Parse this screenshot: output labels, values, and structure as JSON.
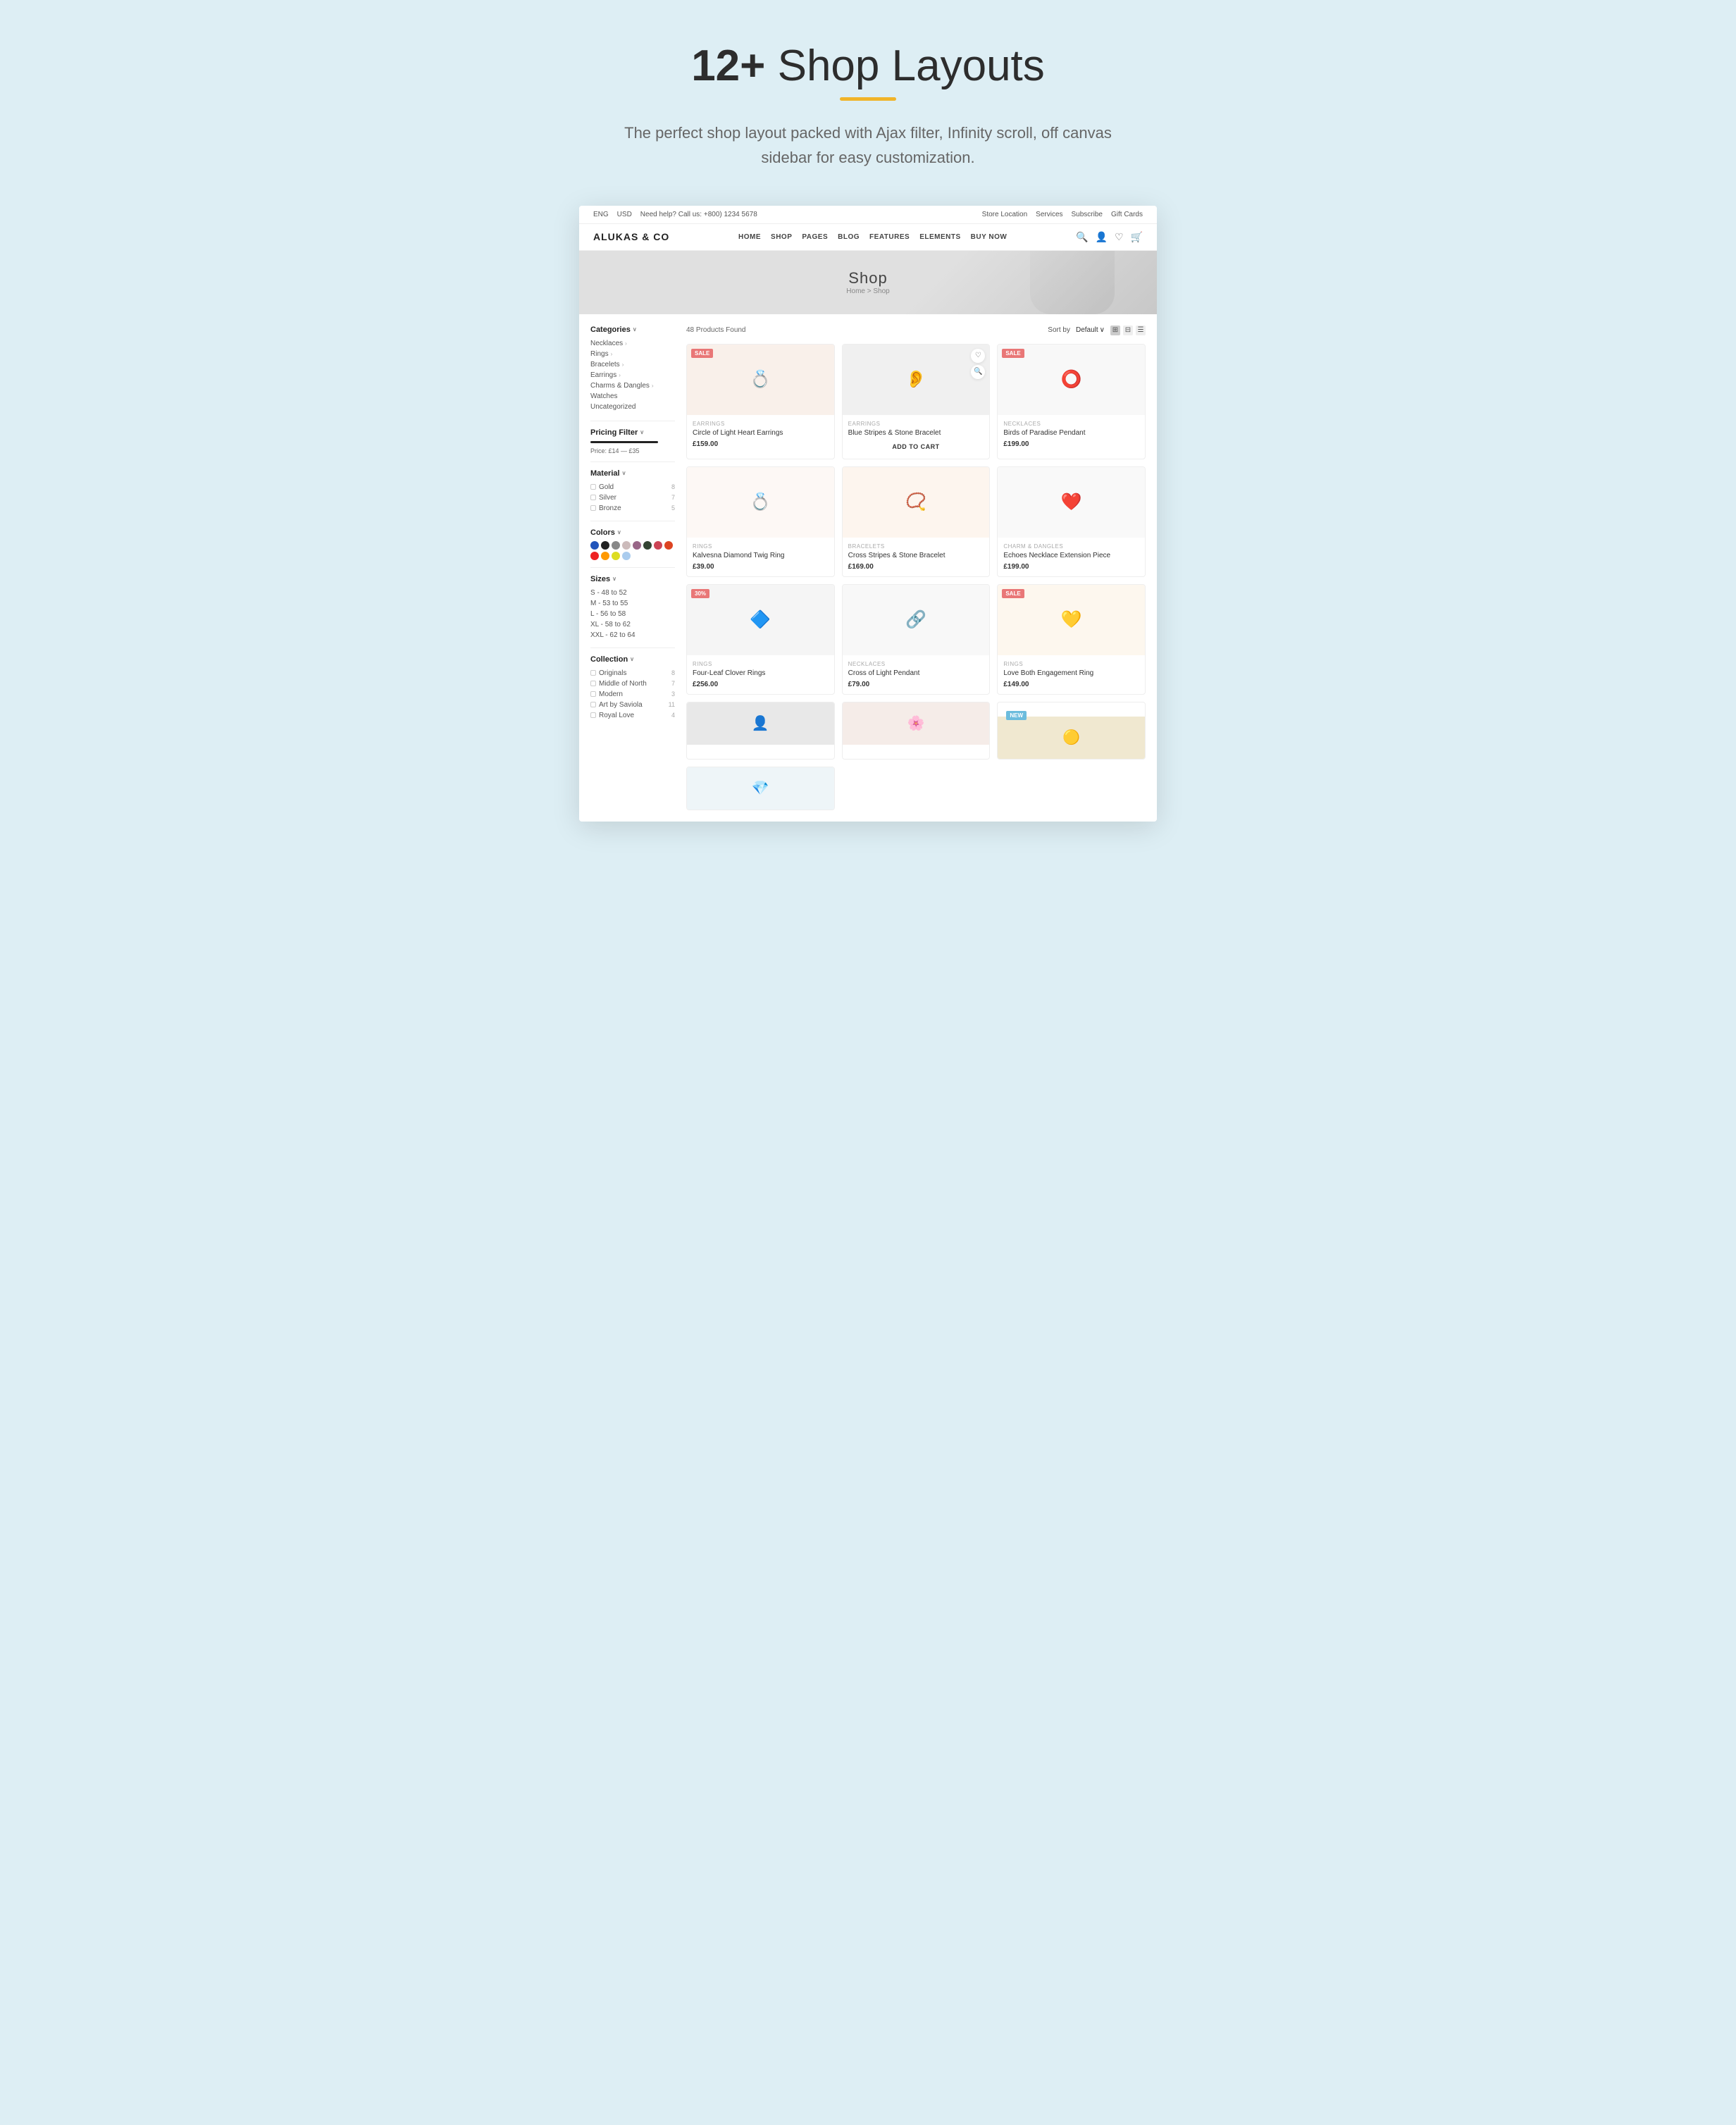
{
  "hero": {
    "title_bold": "12+",
    "title_regular": " Shop Layouts",
    "subtitle": "The perfect shop layout packed with Ajax filter, Infinity scroll, off canvas sidebar for easy customization.",
    "underline_color": "#f0b429"
  },
  "topbar": {
    "lang": "ENG",
    "currency": "USD",
    "phone_label": "Need help? Call us:",
    "phone": "+800) 1234 5678",
    "store_location": "Store Location",
    "services": "Services",
    "subscribe": "Subscribe",
    "gift_cards": "Gift Cards"
  },
  "nav": {
    "logo": "ALUKAS & CO",
    "links": [
      "HOME",
      "SHOP",
      "PAGES",
      "BLOG",
      "FEATURES",
      "ELEMENTS",
      "BUY NOW"
    ]
  },
  "banner": {
    "title": "Shop",
    "breadcrumb": "Home > Shop"
  },
  "products_count": "48 Products Found",
  "sort_label": "Sort by",
  "sort_value": "Default",
  "sidebar": {
    "categories": {
      "title": "Categories",
      "items": [
        {
          "label": "Necklaces",
          "has_arrow": true
        },
        {
          "label": "Rings",
          "has_arrow": true
        },
        {
          "label": "Bracelets",
          "has_arrow": true
        },
        {
          "label": "Earrings",
          "has_arrow": true
        },
        {
          "label": "Charms & Dangles",
          "has_arrow": true
        },
        {
          "label": "Watches"
        },
        {
          "label": "Uncategorized"
        }
      ]
    },
    "pricing": {
      "title": "Pricing Filter",
      "label": "Price: £14 — £35"
    },
    "material": {
      "title": "Material",
      "items": [
        {
          "label": "Gold",
          "count": "8"
        },
        {
          "label": "Silver",
          "count": "7"
        },
        {
          "label": "Bronze",
          "count": "5"
        }
      ]
    },
    "colors": {
      "title": "Colors",
      "swatches": [
        "#2255bb",
        "#222222",
        "#888888",
        "#ccbbbb",
        "#996688",
        "#334433",
        "#cc4455",
        "#dd4422",
        "#ee2222",
        "#ff9900",
        "#dddd22",
        "#aaccee"
      ]
    },
    "sizes": {
      "title": "Sizes",
      "items": [
        "S - 48 to 52",
        "M - 53 to 55",
        "L - 56 to 58",
        "XL - 58 to 62",
        "XXL - 62 to 64"
      ]
    },
    "collection": {
      "title": "Collection",
      "items": [
        {
          "label": "Originals",
          "count": "8"
        },
        {
          "label": "Middle of North",
          "count": "7"
        },
        {
          "label": "Modern",
          "count": "3"
        },
        {
          "label": "Art by Saviola",
          "count": "11"
        },
        {
          "label": "Royal Love",
          "count": "4"
        }
      ]
    }
  },
  "products": [
    {
      "badge": "SALE",
      "badge_type": "sale",
      "category": "EARRINGS",
      "name": "Circle of Light Heart Earrings",
      "price": "£159.00",
      "icon": "💍",
      "bg": "#f9f0ea"
    },
    {
      "badge": "",
      "badge_type": "",
      "category": "EARRINGS",
      "name": "Blue Stripes & Stone Bracelet",
      "price": "",
      "cta": "ADD TO CART",
      "icon": "👂",
      "bg": "#f5f5f5"
    },
    {
      "badge": "SALE",
      "badge_type": "sale",
      "category": "NECKLACES",
      "name": "Birds of Paradise Pendant",
      "price": "£199.00",
      "icon": "⭕",
      "bg": "#f8f8f8"
    },
    {
      "badge": "",
      "badge_type": "",
      "category": "RINGS",
      "name": "Kalvesna Diamond Twig Ring",
      "price": "£39.00",
      "icon": "💍",
      "bg": "#fdf8f5"
    },
    {
      "badge": "",
      "badge_type": "",
      "category": "BRACELETS",
      "name": "Cross Stripes & Stone Bracelet",
      "price": "£169.00",
      "icon": "📿",
      "bg": "#fdf5ee"
    },
    {
      "badge": "",
      "badge_type": "",
      "category": "CHARM & DANGLES",
      "name": "Echoes Necklace Extension Piece",
      "price": "£199.00",
      "icon": "❤️",
      "bg": "#f9f9f9"
    },
    {
      "badge": "30%",
      "badge_type": "percent",
      "category": "RINGS",
      "name": "Four-Leaf Clover Rings",
      "price": "£256.00",
      "icon": "🔷",
      "bg": "#f5f5f5"
    },
    {
      "badge": "",
      "badge_type": "",
      "category": "NECKLACES",
      "name": "Cross of Light Pendant",
      "price": "£79.00",
      "icon": "🔗",
      "bg": "#f8f8f8"
    },
    {
      "badge": "SALE",
      "badge_type": "sale",
      "category": "RINGS",
      "name": "Love Both Engagement Ring",
      "price": "£149.00",
      "icon": "💛",
      "bg": "#fdf7ee"
    }
  ],
  "partial_products": [
    {
      "icon": "👤",
      "bg": "#e8e8e8",
      "badge": "",
      "badge_type": ""
    },
    {
      "icon": "🌸",
      "bg": "#f5ece8",
      "badge": "",
      "badge_type": ""
    },
    {
      "icon": "🟡",
      "bg": "#f0e8d0",
      "badge": "NEW",
      "badge_type": "new"
    },
    {
      "icon": "💎",
      "bg": "#eef5f8",
      "badge": "",
      "badge_type": ""
    }
  ]
}
